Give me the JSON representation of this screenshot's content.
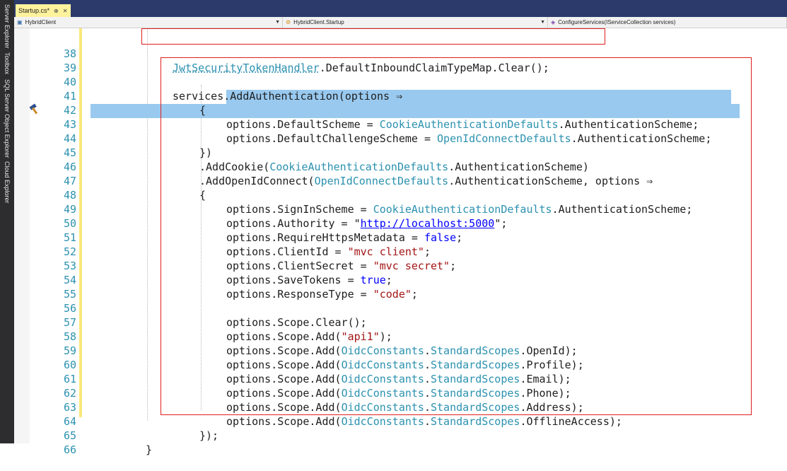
{
  "side_tabs": [
    "Server Explorer",
    "Toolbox",
    "SQL Server Object Explorer",
    "Cloud Explorer"
  ],
  "tab": {
    "title": "Startup.cs*",
    "pin": "⊕",
    "close": "✕"
  },
  "nav": {
    "project": "HybridClient",
    "class": "HybridClient.Startup",
    "member": "ConfigureServices(IServiceCollection services)"
  },
  "editor": {
    "line_numbers": [
      "38",
      "39",
      "40",
      "41",
      "42",
      "43",
      "44",
      "45",
      "46",
      "47",
      "48",
      "49",
      "50",
      "51",
      "52",
      "53",
      "54",
      "55",
      "56",
      "57",
      "58",
      "59",
      "60",
      "61",
      "62",
      "63",
      "64",
      "65",
      "66"
    ],
    "line38": {
      "type": "JwtSecurityTokenHandler",
      "rest": ".DefaultInboundClaimTypeMap.Clear();"
    },
    "line40": "services.AddAuthentication(options ⇒",
    "line41": "{",
    "line42": {
      "a": "options.DefaultScheme = ",
      "type": "CookieAuthenticationDefaults",
      "b": ".AuthenticationScheme;"
    },
    "line43": {
      "a": "options.DefaultChallengeScheme = ",
      "type": "OpenIdConnectDefaults",
      "b": ".AuthenticationScheme;"
    },
    "line44": "})",
    "line45": {
      "a": ".AddCookie(",
      "type": "CookieAuthenticationDefaults",
      "b": ".AuthenticationScheme)"
    },
    "line46": {
      "a": ".AddOpenIdConnect(",
      "type": "OpenIdConnectDefaults",
      "b": ".AuthenticationScheme, options ⇒"
    },
    "line47": "{",
    "line48": {
      "a": "options.SignInScheme = ",
      "type": "CookieAuthenticationDefaults",
      "b": ".AuthenticationScheme;"
    },
    "line49": {
      "a": "options.Authority = \"",
      "url": "http://localhost:5000",
      "b": "\";"
    },
    "line50": {
      "a": "options.RequireHttpsMetadata = ",
      "kw": "false",
      "b": ";"
    },
    "line51": {
      "a": "options.ClientId = ",
      "str": "\"mvc client\"",
      "b": ";"
    },
    "line52": {
      "a": "options.ClientSecret = ",
      "str": "\"mvc secret\"",
      "b": ";"
    },
    "line53": {
      "a": "options.SaveTokens = ",
      "kw": "true",
      "b": ";"
    },
    "line54": {
      "a": "options.ResponseType = ",
      "str": "\"code\"",
      "b": ";"
    },
    "line56": "options.Scope.Clear();",
    "line57": {
      "a": "options.Scope.Add(",
      "str": "\"api1\"",
      "b": ");"
    },
    "scope_prefix": "options.Scope.Add(",
    "oidc_type": "OidcConstants",
    "scopes_type": "StandardScopes",
    "scope_items": [
      ".OpenId);",
      ".Profile);",
      ".Email);",
      ".Phone);",
      ".Address);",
      ".OfflineAccess);"
    ],
    "line64": "});",
    "line65": "}"
  },
  "colors": {
    "type": "#2b91af",
    "string": "#a31515",
    "keyword": "#0000ff",
    "selection": "#99c9ef",
    "annotation_box": "#e01e1e",
    "tab_active": "#fff29d"
  }
}
